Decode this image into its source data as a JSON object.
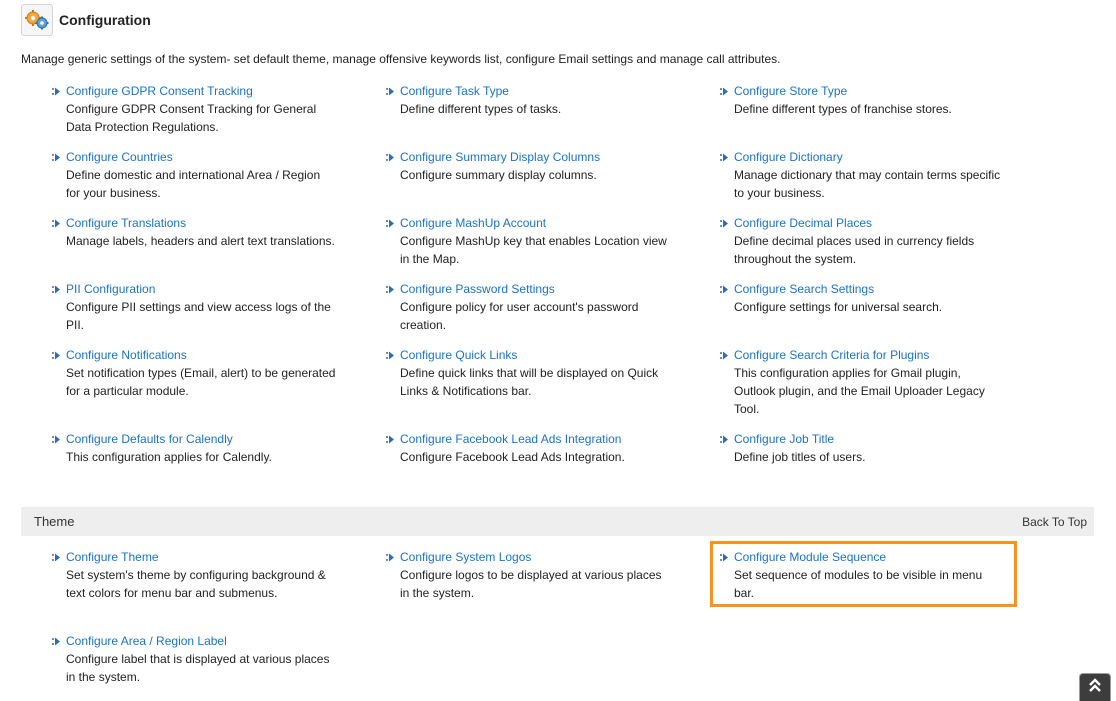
{
  "header": {
    "icon": "gears-icon",
    "title": "Configuration"
  },
  "description": "Manage generic settings of the system- set default theme, manage offensive keywords list, configure Email settings and manage call attributes.",
  "config_items": [
    {
      "name": "gdpr",
      "link": "Configure GDPR Consent Tracking",
      "desc": "Configure GDPR Consent Tracking for General Data Protection Regulations."
    },
    {
      "name": "task-type",
      "link": "Configure Task Type",
      "desc": "Define different types of tasks."
    },
    {
      "name": "store-type",
      "link": "Configure Store Type",
      "desc": "Define different types of franchise stores."
    },
    {
      "name": "countries",
      "link": "Configure Countries",
      "desc": "Define domestic and international Area / Region for your business."
    },
    {
      "name": "summary-display-columns",
      "link": "Configure Summary Display Columns",
      "desc": "Configure summary display columns."
    },
    {
      "name": "dictionary",
      "link": "Configure Dictionary",
      "desc": "Manage dictionary that may contain terms specific to your business."
    },
    {
      "name": "translations",
      "link": "Configure Translations",
      "desc": "Manage labels, headers and alert text translations."
    },
    {
      "name": "mashup-account",
      "link": "Configure MashUp Account",
      "desc": "Configure MashUp key that enables Location view in the Map."
    },
    {
      "name": "decimal-places",
      "link": "Configure Decimal Places",
      "desc": "Define decimal places used in currency fields throughout the system."
    },
    {
      "name": "pii",
      "link": "PII Configuration",
      "desc": "Configure PII settings and view access logs of the PII."
    },
    {
      "name": "password-settings",
      "link": "Configure Password Settings",
      "desc": "Configure policy for user account's password creation."
    },
    {
      "name": "search-settings",
      "link": "Configure Search Settings",
      "desc": "Configure settings for universal search."
    },
    {
      "name": "notifications",
      "link": "Configure Notifications",
      "desc": "Set notification types (Email, alert) to be generated for a particular module."
    },
    {
      "name": "quick-links",
      "link": "Configure Quick Links",
      "desc": "Define quick links that will be displayed on Quick Links & Notifications bar."
    },
    {
      "name": "search-criteria-plugins",
      "link": "Configure Search Criteria for Plugins",
      "desc": "This configuration applies for Gmail plugin, Outlook plugin, and the Email Uploader Legacy Tool."
    },
    {
      "name": "calendly",
      "link": "Configure Defaults for Calendly",
      "desc": "This configuration applies for Calendly."
    },
    {
      "name": "facebook-lead-ads",
      "link": "Configure Facebook Lead Ads Integration",
      "desc": "Configure Facebook Lead Ads Integration."
    },
    {
      "name": "job-title",
      "link": "Configure Job Title",
      "desc": "Define job titles of users."
    }
  ],
  "theme_section": {
    "title": "Theme",
    "back_to_top": "Back To Top",
    "items": [
      {
        "name": "theme",
        "link": "Configure Theme",
        "desc": "Set system's theme by configuring background & text colors for menu bar and submenus."
      },
      {
        "name": "system-logos",
        "link": "Configure System Logos",
        "desc": "Configure logos to be displayed at various places in the system."
      },
      {
        "name": "module-sequence",
        "link": "Configure Module Sequence",
        "desc": "Set sequence of modules to be visible in menu bar."
      },
      {
        "name": "area-region-label",
        "link": "Configure Area / Region Label",
        "desc": "Configure label that is displayed at various places in the system."
      }
    ]
  },
  "colors": {
    "link": "#1a73c9",
    "highlight": "#f7931e",
    "section_bar": "#eeeeee"
  },
  "scroll_top": {
    "icon": "double-chevron-up-icon"
  }
}
